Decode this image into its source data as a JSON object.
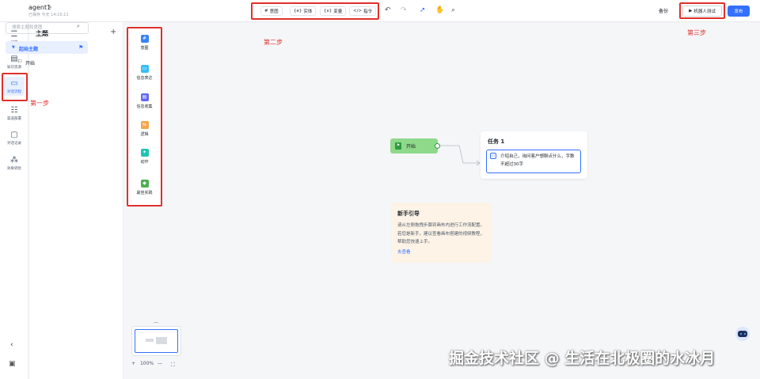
{
  "header": {
    "agent_name": "agent1",
    "save_status": "已保存 今天 14:15:11",
    "toolbar": {
      "intent": "意图",
      "entity": "实体",
      "variable": "变量",
      "command": "指令"
    },
    "backup": "备份",
    "robot_test": "机器人测试",
    "publish": "发布"
  },
  "rail": {
    "items": [
      {
        "label": "配置",
        "icon": "sliders-icon"
      },
      {
        "label": "知识资源",
        "icon": "document-icon"
      },
      {
        "label": "对话流程",
        "icon": "folder-flow-icon"
      },
      {
        "label": "渠道部署",
        "icon": "server-icon"
      },
      {
        "label": "对话记录",
        "icon": "chat-icon"
      },
      {
        "label": "效果调优",
        "icon": "network-icon"
      }
    ]
  },
  "topic_panel": {
    "title": "主题",
    "search_placeholder": "搜索主题和意图",
    "active_topic": "起始主题",
    "sub_item": "开始"
  },
  "palette": {
    "items": [
      {
        "label": "意图",
        "color": "#3b82f6"
      },
      {
        "label": "信息表达",
        "color": "#38bdf8"
      },
      {
        "label": "信息收集",
        "color": "#6366f1"
      },
      {
        "label": "逻辑",
        "color": "#f5a54a"
      },
      {
        "label": "动作",
        "color": "#22c3b5"
      },
      {
        "label": "最佳实践",
        "color": "#4caf50"
      }
    ]
  },
  "annotations": {
    "step1": "第一步",
    "step2": "第二步",
    "step3": "第三步"
  },
  "canvas": {
    "start_node": "开始",
    "task_title": "任务 1",
    "task_text": "介绍自己，询问客户想聊点什么，字数不超过30字"
  },
  "guide": {
    "title": "新手引导",
    "body": "请从左侧拖拽步骤到画布内进行工作流配置。若您是新手，建议查看画布搭建的视频教程，帮助您快速上手。",
    "link": "去查看"
  },
  "minimap": {
    "zoom": "100%"
  },
  "watermark": "掘金技术社区 @ 生活在北极圈的水冰月"
}
